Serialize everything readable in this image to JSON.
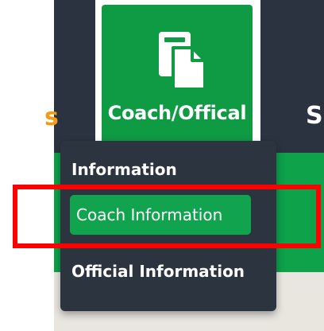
{
  "tile": {
    "label": "Coach/Offical",
    "icon": "copy-documents-icon"
  },
  "left_edge_text": "s",
  "right_edge_text": "S",
  "dropdown": {
    "header": "Information",
    "items": [
      {
        "label": "Coach Information",
        "active": true
      },
      {
        "label": "Official Information",
        "active": false
      }
    ]
  },
  "colors": {
    "tile_green": "#0f9a44",
    "active_green": "#12a34e",
    "dropdown_bg": "#2c3440",
    "highlight_red": "#ff0000"
  }
}
